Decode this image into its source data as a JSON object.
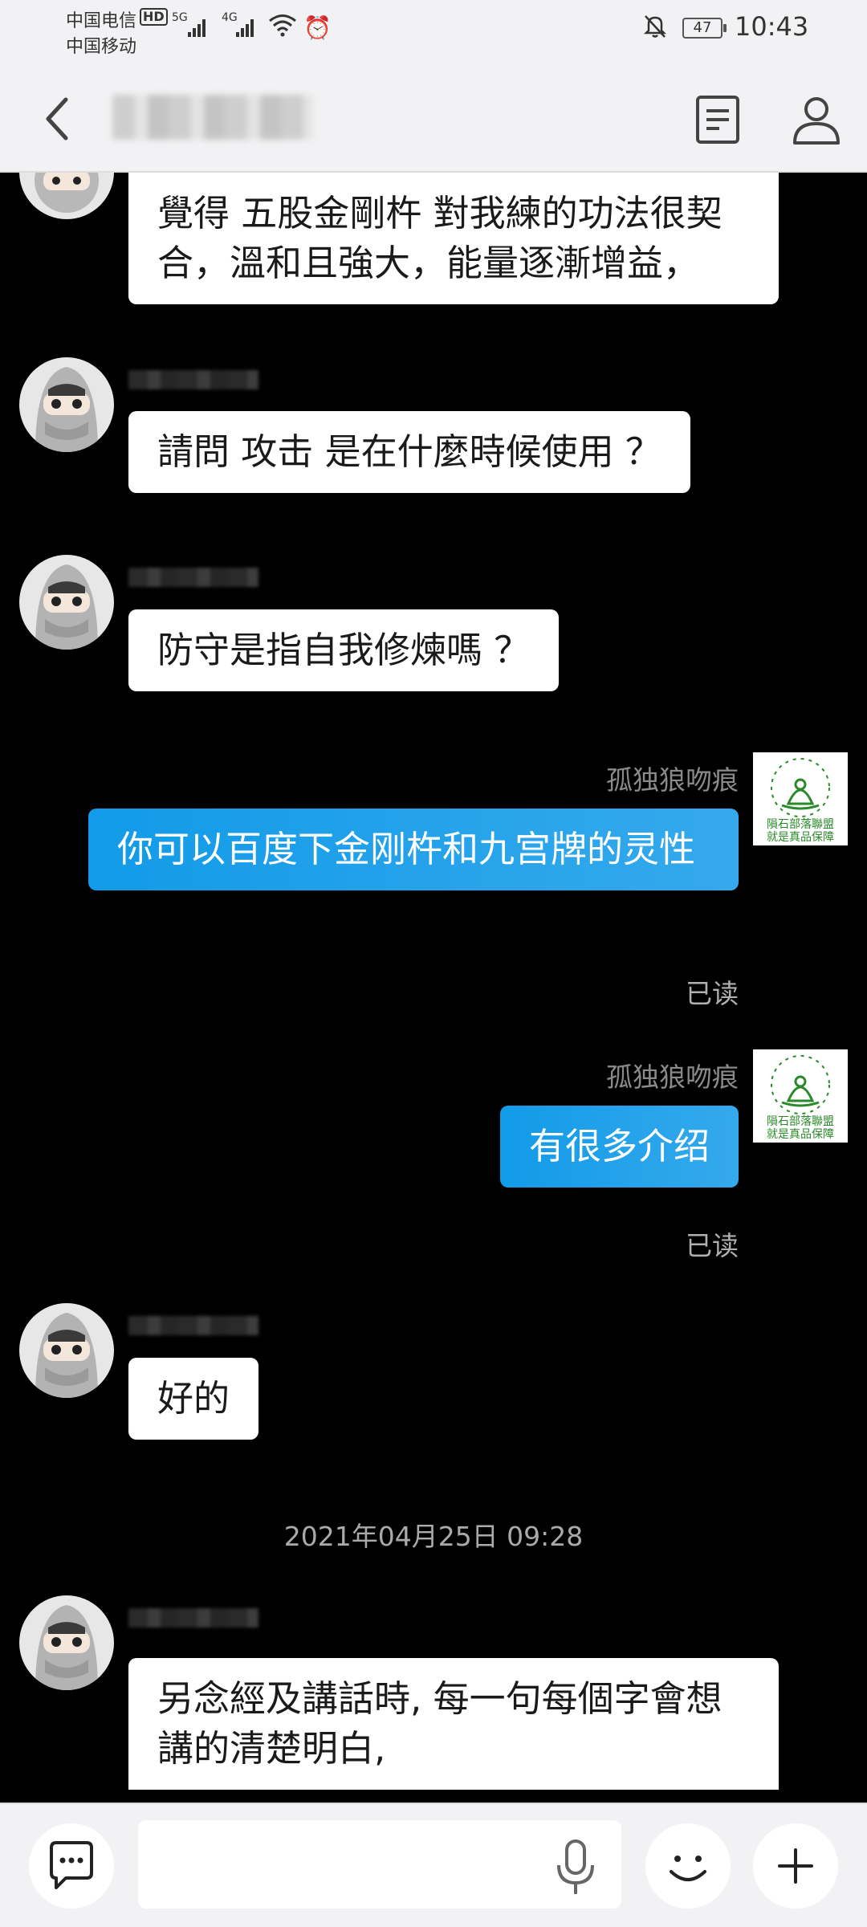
{
  "status_bar": {
    "carrier_1": "中国电信",
    "carrier_1_badge": "HD",
    "carrier_2": "中国移动",
    "signal_1_label": "5G",
    "signal_2_label": "4G",
    "battery": "47",
    "time": "10:43"
  },
  "header": {
    "back_icon": "chevron-left-icon",
    "doc_icon": "document-icon",
    "profile_icon": "person-icon"
  },
  "messages": [
    {
      "from": "other",
      "text": "覺得 五股金剛杵 對我練的功法很契合，溫和且強大，能量逐漸增益，"
    },
    {
      "from": "other",
      "text": "請問  攻击 是在什麼時候使用 ？"
    },
    {
      "from": "other",
      "text": "防守是指自我修煉嗎 ？"
    },
    {
      "from": "me",
      "name": "孤独狼吻痕",
      "text": "你可以百度下金刚杵和九宫牌的灵性",
      "status": "已读"
    },
    {
      "from": "me",
      "name": "孤独狼吻痕",
      "text": "有很多介绍",
      "status": "已读"
    },
    {
      "from": "other",
      "text": "好的"
    },
    {
      "from": "other",
      "text": "另念經及講話時, 每一句每個字會想講的清楚明白,"
    }
  ],
  "timestamp": "2021年04月25日 09:28",
  "my_avatar": {
    "line1": "隕石部落聯盟",
    "line2": "就是真品保障"
  },
  "input_bar": {
    "placeholder": "",
    "chat_icon": "chat-bubble-icon",
    "mic_icon": "microphone-icon",
    "emoji_icon": "smiley-icon",
    "plus_icon": "plus-icon"
  }
}
